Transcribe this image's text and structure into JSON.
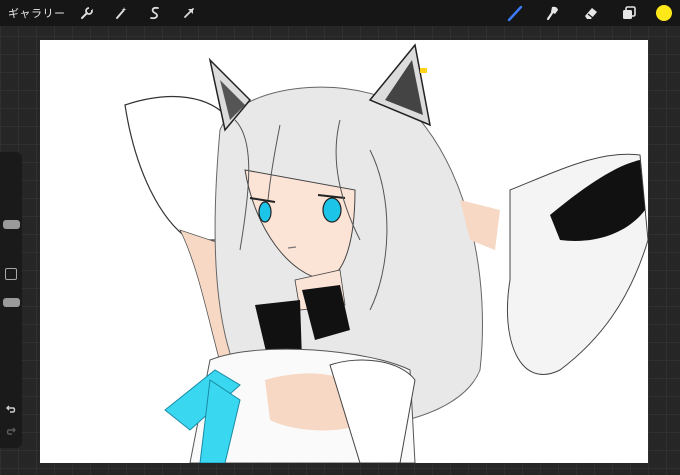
{
  "app": {
    "gallery_label": "ギャラリー"
  },
  "toolbar": {
    "left_tools": [
      {
        "icon": "wrench-icon"
      },
      {
        "icon": "magic-wand-icon"
      },
      {
        "icon": "selection-icon"
      },
      {
        "icon": "transform-arrow-icon"
      }
    ],
    "right_tools": [
      {
        "icon": "brush-icon",
        "active": true,
        "color": "#3d7bff"
      },
      {
        "icon": "smudge-icon"
      },
      {
        "icon": "eraser-icon"
      },
      {
        "icon": "layers-icon"
      }
    ],
    "current_color": "#ffe81a"
  },
  "sidebar": {
    "brush_size_level": 0.32,
    "opacity_level": 0.58
  }
}
